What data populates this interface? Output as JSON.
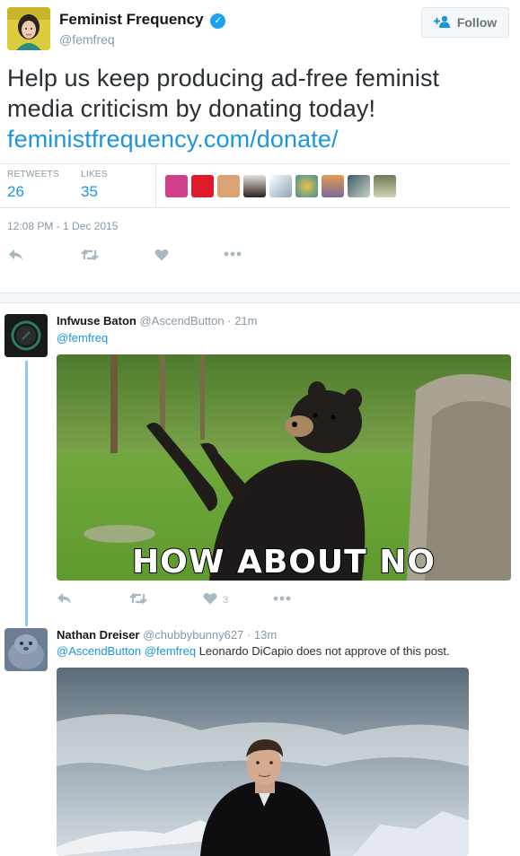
{
  "main_tweet": {
    "author_name": "Feminist Frequency",
    "verified_icon": "verified-badge-icon",
    "author_handle": "@femfreq",
    "follow_label": "Follow",
    "text_line1": "Help us keep producing ad-free feminist",
    "text_line2": "media criticism by donating today!",
    "link": "feministfrequency.com/donate/",
    "retweets_label": "RETWEETS",
    "retweets_count": "26",
    "likes_label": "LIKES",
    "likes_count": "35",
    "timestamp": "12:08 PM - 1 Dec 2015",
    "actions": [
      "reply-icon",
      "retweet-icon",
      "like-icon",
      "more-icon"
    ]
  },
  "replies": [
    {
      "name": "Infwuse Baton",
      "handle": "@AscendButton",
      "time": "· 21m",
      "mention": "@femfreq",
      "media_caption": "HOW ABOUT NO",
      "like_count": "3"
    },
    {
      "name": "Nathan Dreiser",
      "handle": "@chubbybunny627",
      "time": "· 13m",
      "mention1": "@AscendButton",
      "mention2": "@femfreq",
      "text": "Leonardo DiCapio does not approve of this post."
    }
  ],
  "colors": {
    "link": "#1b95e0",
    "verified": "#1da1f2",
    "muted": "#8899a6",
    "thread_line": "#8ec9f3"
  }
}
